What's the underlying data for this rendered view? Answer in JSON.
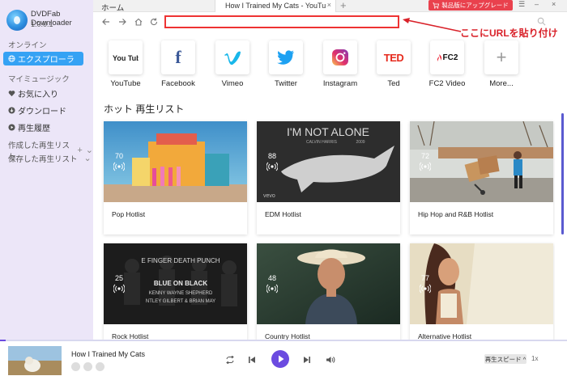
{
  "sidebar": {
    "app_name": "DVDFab Downloader",
    "version": "1.0.0.1",
    "online_label": "オンライン",
    "explorer_label": "エクスプローラ",
    "mymusic_label": "マイミュージック",
    "favorites_label": "お気に入り",
    "downloads_label": "ダウンロード",
    "history_label": "再生履歴",
    "created_playlist_label": "作成した再生リスト",
    "saved_playlist_label": "保存した再生リスト"
  },
  "topbar": {
    "home_label": "ホーム",
    "tab_title": "How I Trained My Cats - YouTu",
    "tab_close": "×",
    "new_tab": "+",
    "upgrade_label": "製品版にアップグレード",
    "win_menu": "☰",
    "win_min": "–",
    "win_close": "×"
  },
  "navbar": {
    "url_value": "",
    "annotation": "ここにURLを貼り付け"
  },
  "sites": [
    {
      "label": "YouTube",
      "icon": "youtube-icon"
    },
    {
      "label": "Facebook",
      "icon": "facebook-icon"
    },
    {
      "label": "Vimeo",
      "icon": "vimeo-icon"
    },
    {
      "label": "Twitter",
      "icon": "twitter-icon"
    },
    {
      "label": "Instagram",
      "icon": "instagram-icon"
    },
    {
      "label": "Ted",
      "icon": "ted-icon"
    },
    {
      "label": "FC2 Video",
      "icon": "fc2-icon"
    },
    {
      "label": "More...",
      "icon": "plus-icon"
    }
  ],
  "site_logos": {
    "youtube": "You Tube",
    "facebook": "f",
    "ted": "TED",
    "fc2": "FC2",
    "more": "+"
  },
  "hot": {
    "title": "ホット 再生リスト",
    "cards": [
      {
        "count": "70",
        "label": "Pop Hotlist"
      },
      {
        "count": "88",
        "label": "EDM Hotlist"
      },
      {
        "count": "72",
        "label": "Hip Hop and R&B Hotlist"
      },
      {
        "count": "25",
        "label": "Rock Hotlist"
      },
      {
        "count": "48",
        "label": "Country Hotlist"
      },
      {
        "count": "77",
        "label": "Alternative Hotlist"
      }
    ],
    "thumb_texts": {
      "edm_main": "I'M NOT ALONE",
      "edm_sub": "CALVIN HARRIS",
      "edm_year": "2009",
      "edm_brand": "vevo",
      "rock_l1": "E FINGER DEATH PUNCH",
      "rock_l2": "BLUE ON BLACK",
      "rock_l3": "KENNY WAYNE SHEPHERD",
      "rock_l4": "NTLEY GILBERT & BRIAN MAY"
    }
  },
  "player": {
    "now_playing": "How I Trained My Cats",
    "speed_label": "再生スピード ^",
    "speed_icon": "1x",
    "progress": 0.01
  },
  "colors": {
    "accent": "#6b4be0",
    "explorer_bg": "#35a2f4",
    "upgrade_bg": "#e9414d",
    "annotation": "#d9222a"
  }
}
